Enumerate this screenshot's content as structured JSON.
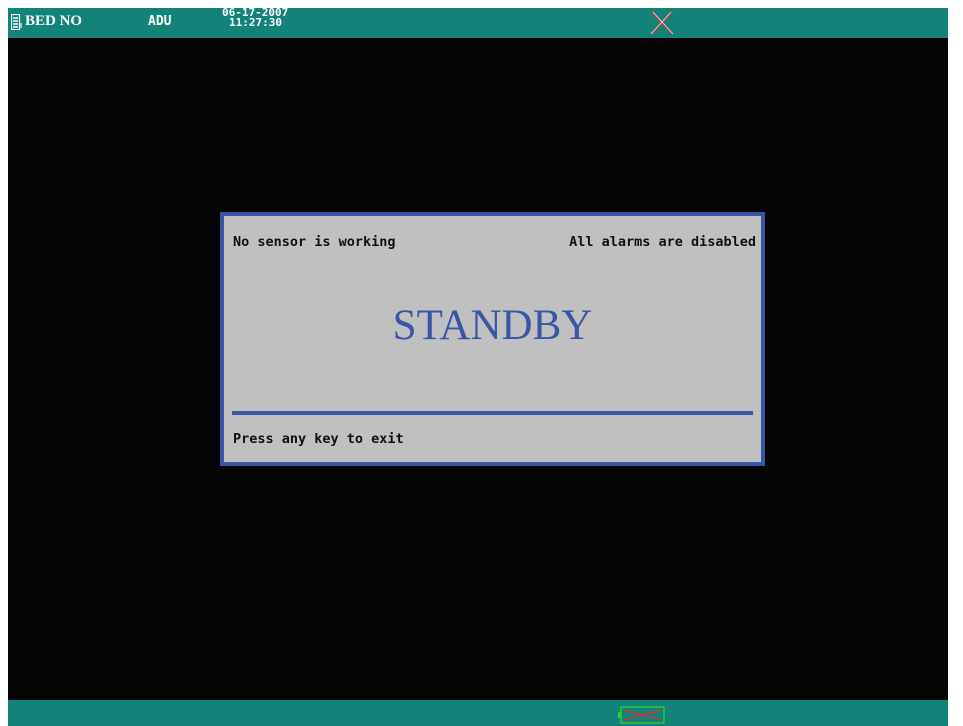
{
  "header": {
    "bed_label": "BED NO",
    "patient_type": "ADU",
    "date": "06-17-2007",
    "time": "11:27:30",
    "icons": [
      "bed-icon",
      "alarm-off-icon"
    ]
  },
  "dialog": {
    "sensor_status": "No sensor is working",
    "alarm_status": "All alarms are disabled",
    "title": "STANDBY",
    "exit_hint": "Press any key to exit"
  },
  "footer": {
    "icons": [
      "battery-icon"
    ]
  },
  "colors": {
    "bar": "#138379",
    "background": "#050505",
    "dialog_bg": "#c0c0c0",
    "accent_blue": "#3a55a5",
    "alarm_x": "#c83a3a",
    "battery": "#2fd02f"
  }
}
